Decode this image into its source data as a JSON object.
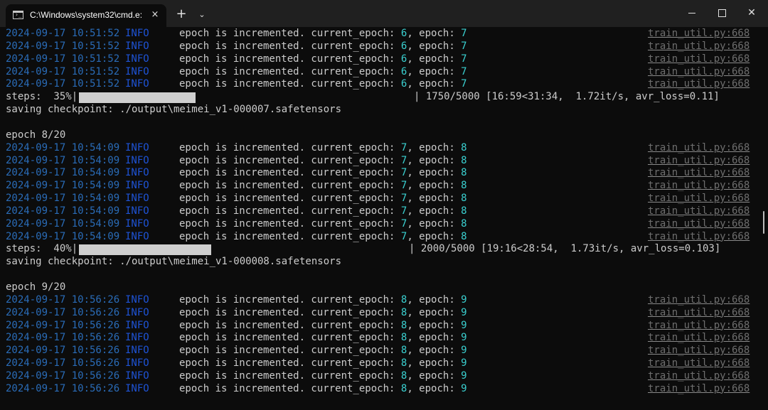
{
  "window": {
    "tab_title": "C:\\Windows\\system32\\cmd.e:",
    "tab_close": "×",
    "new_tab": "+",
    "dropdown": "⌄",
    "close_symbol": "✕"
  },
  "log_sections": [
    {
      "header": null,
      "timestamp": "2024-09-17 10:51:52",
      "level": "INFO",
      "message": "epoch is incremented. current_epoch: ",
      "current_epoch": "6",
      "epoch": "7",
      "source": "train_util.py:668",
      "repeat": 5,
      "progress": {
        "label": "steps:  35%|",
        "percent": 35,
        "tail": "| 1750/5000 [16:59<31:34,  1.72it/s, avr_loss=0.11]"
      },
      "checkpoint": "saving checkpoint: ./output\\meimei_v1-000007.safetensors"
    },
    {
      "header": "epoch 8/20",
      "timestamp": "2024-09-17 10:54:09",
      "level": "INFO",
      "message": "epoch is incremented. current_epoch: ",
      "current_epoch": "7",
      "epoch": "8",
      "source": "train_util.py:668",
      "repeat": 8,
      "progress": {
        "label": "steps:  40%|",
        "percent": 40,
        "tail": "| 2000/5000 [19:16<28:54,  1.73it/s, avr_loss=0.103]"
      },
      "checkpoint": "saving checkpoint: ./output\\meimei_v1-000008.safetensors"
    },
    {
      "header": "epoch 9/20",
      "timestamp": "2024-09-17 10:56:26",
      "level": "INFO",
      "message": "epoch is incremented. current_epoch: ",
      "current_epoch": "8",
      "epoch": "9",
      "source": "train_util.py:668",
      "repeat": 8,
      "progress": null,
      "checkpoint": null
    }
  ]
}
